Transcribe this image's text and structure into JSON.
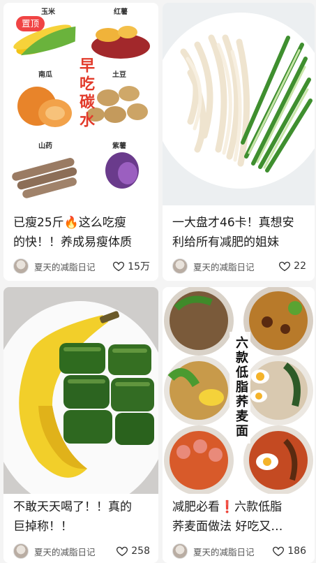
{
  "feed": {
    "cards": [
      {
        "pin_badge": "置顶",
        "image_labels": [
          "玉米",
          "红薯",
          "南瓜",
          "土豆",
          "山药",
          "紫薯"
        ],
        "image_headline": "早吃碳水",
        "title_lines": [
          "已瘦25斤🔥这么吃瘦",
          "的快！！养成易瘦体质"
        ],
        "author": "夏天的减脂日记",
        "likes": "15万"
      },
      {
        "title_lines": [
          "一大盘才46卡！真想安",
          "利给所有减肥的姐妹"
        ],
        "author": "夏天的减脂日记",
        "likes": "22"
      },
      {
        "title_lines": [
          "不敢天天喝了！！真的",
          "巨掉称！！"
        ],
        "author": "夏天的减脂日记",
        "likes": "258"
      },
      {
        "image_headline": "六款低脂荞麦面",
        "title_lines": [
          "减肥必看❗六款低脂",
          "荞麦面做法 好吃又…"
        ],
        "author": "夏天的减脂日记",
        "likes": "186"
      }
    ],
    "colors": {
      "badge": "#f04444",
      "headline_red": "#e23a2a",
      "background": "#f4f4f4"
    },
    "icons": {
      "like": "heart-outline-icon"
    }
  }
}
